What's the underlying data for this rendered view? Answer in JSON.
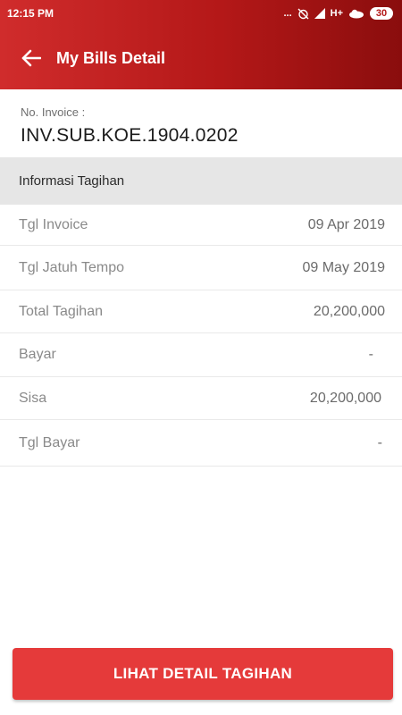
{
  "status_bar": {
    "time": "12:15 PM",
    "signal_text": "...",
    "network": "H+",
    "battery": "30",
    "icons": [
      "alarm-off-icon",
      "signal-icon",
      "network-icon",
      "cloud-icon",
      "battery-icon"
    ]
  },
  "toolbar": {
    "back_icon": "arrow-left-icon",
    "title": "My Bills Detail"
  },
  "invoice": {
    "label": "No. Invoice :",
    "number": "INV.SUB.KOE.1904.0202"
  },
  "section": {
    "title": "Informasi Tagihan"
  },
  "rows": [
    {
      "label": "Tgl Invoice",
      "value": "09 Apr 2019"
    },
    {
      "label": "Tgl Jatuh Tempo",
      "value": "09 May 2019"
    },
    {
      "label": "Total Tagihan",
      "value": "20,200,000"
    },
    {
      "label": "Bayar",
      "value": "-"
    },
    {
      "label": "Sisa",
      "value": "20,200,000"
    },
    {
      "label": "Tgl Bayar",
      "value": "-"
    }
  ],
  "button": {
    "label": "LIHAT DETAIL TAGIHAN"
  },
  "colors": {
    "app_bar_start": "#d02c2c",
    "app_bar_end": "#8a0d0d",
    "button": "#e53a3a",
    "section_header": "#e6e6e6"
  }
}
